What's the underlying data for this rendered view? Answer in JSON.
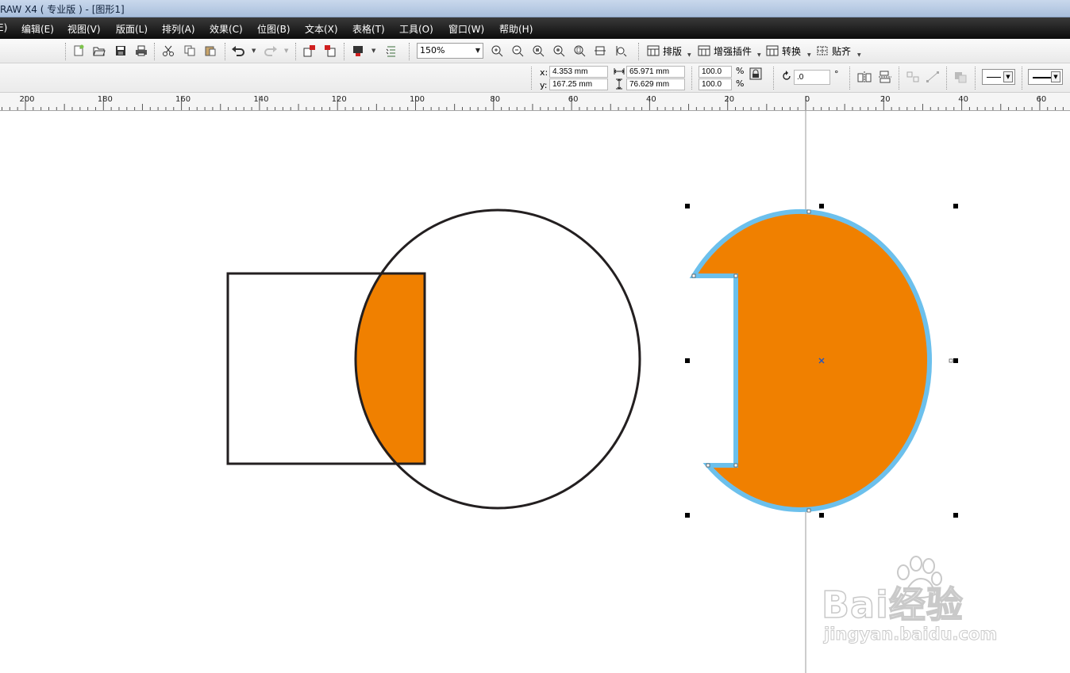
{
  "window": {
    "title": "RAW X4 ( 专业版 ) - [图形1]"
  },
  "menu": [
    "编辑(E)",
    "视图(V)",
    "版面(L)",
    "排列(A)",
    "效果(C)",
    "位图(B)",
    "文本(X)",
    "表格(T)",
    "工具(O)",
    "窗口(W)",
    "帮助(H)"
  ],
  "menu_partial": "E)",
  "toolbar": {
    "zoom": "150%",
    "buttons": [
      "new-icon",
      "open-icon",
      "save-icon",
      "print-icon",
      "cut-icon",
      "copy-icon",
      "paste-icon",
      "undo-icon",
      "redo-icon",
      "import-icon",
      "export-icon",
      "application-launcher-icon",
      "welcome-screen-icon",
      "zoom-in-icon",
      "zoom-out-icon",
      "zoom-selected-icon",
      "zoom-all-icon",
      "zoom-page-icon",
      "zoom-width-icon",
      "zoom-height-icon"
    ],
    "text_buttons": [
      "排版",
      "增强插件",
      "转换",
      "贴齐"
    ]
  },
  "properties": {
    "x_label": "x:",
    "x": "4.353 mm",
    "y_label": "y:",
    "y": "167.25 mm",
    "width": "65.971 mm",
    "height": "76.629 mm",
    "scale_x": "100.0",
    "scale_y": "100.0",
    "percent": "%",
    "rotation": ".0",
    "degree": "°"
  },
  "ruler": {
    "labels": [
      "200",
      "180",
      "160",
      "140",
      "120",
      "100",
      "80",
      "60",
      "40",
      "20",
      "0",
      "20",
      "40",
      "60"
    ]
  },
  "drawing": {
    "fill_color": "#f08000",
    "outline_color": "#231f20",
    "selection_outline_color": "#6cc0ec",
    "guideline_color": "#9b9b9b"
  },
  "watermark": {
    "brand": "Bai经验",
    "url": "jingyan.baidu.com"
  }
}
